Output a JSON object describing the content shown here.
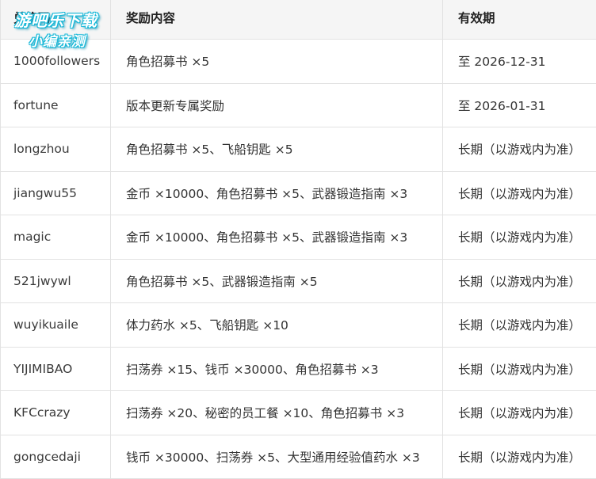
{
  "table": {
    "headers": [
      "兑换码",
      "奖励内容",
      "有效期"
    ],
    "rows": [
      {
        "code": "1000followers",
        "reward": "角色招募书 ×5",
        "validity": "至 2026-12-31"
      },
      {
        "code": "fortune",
        "reward": "版本更新专属奖励",
        "validity": "至 2026-01-31"
      },
      {
        "code": "longzhou",
        "reward": "角色招募书 ×5、飞船钥匙 ×5",
        "validity": "长期（以游戏内为准）"
      },
      {
        "code": "jiangwu55",
        "reward": "金币 ×10000、角色招募书 ×5、武器锻造指南 ×3",
        "validity": "长期（以游戏内为准）"
      },
      {
        "code": "magic",
        "reward": "金币 ×10000、角色招募书 ×5、武器锻造指南 ×3",
        "validity": "长期（以游戏内为准）"
      },
      {
        "code": "521jwywl",
        "reward": "角色招募书 ×5、武器锻造指南 ×5",
        "validity": "长期（以游戏内为准）"
      },
      {
        "code": "wuyikuaile",
        "reward": "体力药水 ×5、飞船钥匙 ×10",
        "validity": "长期（以游戏内为准）"
      },
      {
        "code": "YIJIMIBAO",
        "reward": "扫荡券 ×15、钱币 ×30000、角色招募书 ×3",
        "validity": "长期（以游戏内为准）"
      },
      {
        "code": "KFCcrazy",
        "reward": "扫荡券 ×20、秘密的员工餐 ×10、角色招募书 ×3",
        "validity": "长期（以游戏内为准）"
      },
      {
        "code": "gongcedaji",
        "reward": "钱币 ×30000、扫荡券 ×5、大型通用经验值药水 ×3",
        "validity": "长期（以游戏内为准）"
      }
    ]
  },
  "watermark": {
    "line1": "游吧乐下载",
    "line2": "小编亲测",
    "color": "#17b8d8"
  }
}
